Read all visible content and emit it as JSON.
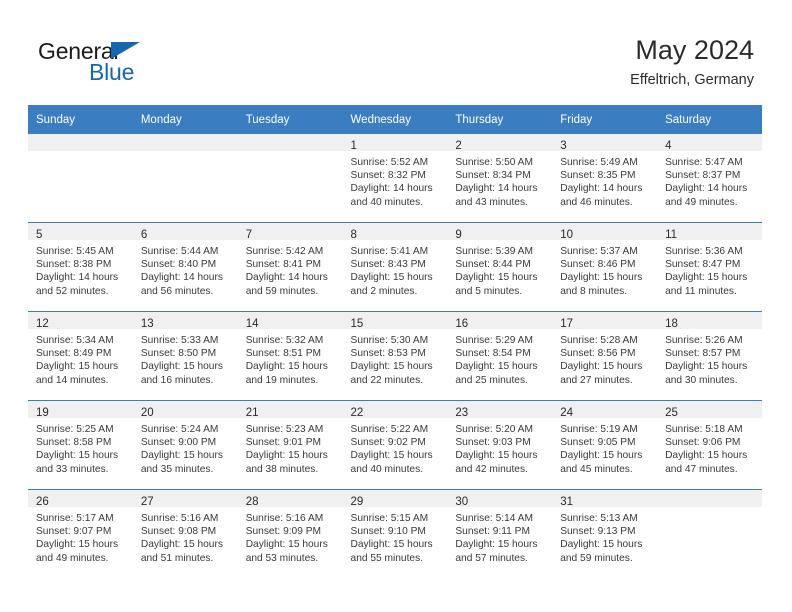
{
  "brand": {
    "name_part1": "General",
    "name_part2": "Blue",
    "triangle_color": "#1666b0",
    "blue_color": "#1666b0"
  },
  "header": {
    "title": "May 2024",
    "subtitle": "Effeltrich, Germany"
  },
  "theme": {
    "header_blue": "#3a7dc1",
    "day_band_gray": "#f0f0f0",
    "text_color": "#3a3a3a"
  },
  "weekday_headers": [
    "Sunday",
    "Monday",
    "Tuesday",
    "Wednesday",
    "Thursday",
    "Friday",
    "Saturday"
  ],
  "weeks": [
    [
      {
        "day": "",
        "sunrise": "",
        "sunset": "",
        "daylight": ""
      },
      {
        "day": "",
        "sunrise": "",
        "sunset": "",
        "daylight": ""
      },
      {
        "day": "",
        "sunrise": "",
        "sunset": "",
        "daylight": ""
      },
      {
        "day": "1",
        "sunrise": "Sunrise: 5:52 AM",
        "sunset": "Sunset: 8:32 PM",
        "daylight": "Daylight: 14 hours and 40 minutes."
      },
      {
        "day": "2",
        "sunrise": "Sunrise: 5:50 AM",
        "sunset": "Sunset: 8:34 PM",
        "daylight": "Daylight: 14 hours and 43 minutes."
      },
      {
        "day": "3",
        "sunrise": "Sunrise: 5:49 AM",
        "sunset": "Sunset: 8:35 PM",
        "daylight": "Daylight: 14 hours and 46 minutes."
      },
      {
        "day": "4",
        "sunrise": "Sunrise: 5:47 AM",
        "sunset": "Sunset: 8:37 PM",
        "daylight": "Daylight: 14 hours and 49 minutes."
      }
    ],
    [
      {
        "day": "5",
        "sunrise": "Sunrise: 5:45 AM",
        "sunset": "Sunset: 8:38 PM",
        "daylight": "Daylight: 14 hours and 52 minutes."
      },
      {
        "day": "6",
        "sunrise": "Sunrise: 5:44 AM",
        "sunset": "Sunset: 8:40 PM",
        "daylight": "Daylight: 14 hours and 56 minutes."
      },
      {
        "day": "7",
        "sunrise": "Sunrise: 5:42 AM",
        "sunset": "Sunset: 8:41 PM",
        "daylight": "Daylight: 14 hours and 59 minutes."
      },
      {
        "day": "8",
        "sunrise": "Sunrise: 5:41 AM",
        "sunset": "Sunset: 8:43 PM",
        "daylight": "Daylight: 15 hours and 2 minutes."
      },
      {
        "day": "9",
        "sunrise": "Sunrise: 5:39 AM",
        "sunset": "Sunset: 8:44 PM",
        "daylight": "Daylight: 15 hours and 5 minutes."
      },
      {
        "day": "10",
        "sunrise": "Sunrise: 5:37 AM",
        "sunset": "Sunset: 8:46 PM",
        "daylight": "Daylight: 15 hours and 8 minutes."
      },
      {
        "day": "11",
        "sunrise": "Sunrise: 5:36 AM",
        "sunset": "Sunset: 8:47 PM",
        "daylight": "Daylight: 15 hours and 11 minutes."
      }
    ],
    [
      {
        "day": "12",
        "sunrise": "Sunrise: 5:34 AM",
        "sunset": "Sunset: 8:49 PM",
        "daylight": "Daylight: 15 hours and 14 minutes."
      },
      {
        "day": "13",
        "sunrise": "Sunrise: 5:33 AM",
        "sunset": "Sunset: 8:50 PM",
        "daylight": "Daylight: 15 hours and 16 minutes."
      },
      {
        "day": "14",
        "sunrise": "Sunrise: 5:32 AM",
        "sunset": "Sunset: 8:51 PM",
        "daylight": "Daylight: 15 hours and 19 minutes."
      },
      {
        "day": "15",
        "sunrise": "Sunrise: 5:30 AM",
        "sunset": "Sunset: 8:53 PM",
        "daylight": "Daylight: 15 hours and 22 minutes."
      },
      {
        "day": "16",
        "sunrise": "Sunrise: 5:29 AM",
        "sunset": "Sunset: 8:54 PM",
        "daylight": "Daylight: 15 hours and 25 minutes."
      },
      {
        "day": "17",
        "sunrise": "Sunrise: 5:28 AM",
        "sunset": "Sunset: 8:56 PM",
        "daylight": "Daylight: 15 hours and 27 minutes."
      },
      {
        "day": "18",
        "sunrise": "Sunrise: 5:26 AM",
        "sunset": "Sunset: 8:57 PM",
        "daylight": "Daylight: 15 hours and 30 minutes."
      }
    ],
    [
      {
        "day": "19",
        "sunrise": "Sunrise: 5:25 AM",
        "sunset": "Sunset: 8:58 PM",
        "daylight": "Daylight: 15 hours and 33 minutes."
      },
      {
        "day": "20",
        "sunrise": "Sunrise: 5:24 AM",
        "sunset": "Sunset: 9:00 PM",
        "daylight": "Daylight: 15 hours and 35 minutes."
      },
      {
        "day": "21",
        "sunrise": "Sunrise: 5:23 AM",
        "sunset": "Sunset: 9:01 PM",
        "daylight": "Daylight: 15 hours and 38 minutes."
      },
      {
        "day": "22",
        "sunrise": "Sunrise: 5:22 AM",
        "sunset": "Sunset: 9:02 PM",
        "daylight": "Daylight: 15 hours and 40 minutes."
      },
      {
        "day": "23",
        "sunrise": "Sunrise: 5:20 AM",
        "sunset": "Sunset: 9:03 PM",
        "daylight": "Daylight: 15 hours and 42 minutes."
      },
      {
        "day": "24",
        "sunrise": "Sunrise: 5:19 AM",
        "sunset": "Sunset: 9:05 PM",
        "daylight": "Daylight: 15 hours and 45 minutes."
      },
      {
        "day": "25",
        "sunrise": "Sunrise: 5:18 AM",
        "sunset": "Sunset: 9:06 PM",
        "daylight": "Daylight: 15 hours and 47 minutes."
      }
    ],
    [
      {
        "day": "26",
        "sunrise": "Sunrise: 5:17 AM",
        "sunset": "Sunset: 9:07 PM",
        "daylight": "Daylight: 15 hours and 49 minutes."
      },
      {
        "day": "27",
        "sunrise": "Sunrise: 5:16 AM",
        "sunset": "Sunset: 9:08 PM",
        "daylight": "Daylight: 15 hours and 51 minutes."
      },
      {
        "day": "28",
        "sunrise": "Sunrise: 5:16 AM",
        "sunset": "Sunset: 9:09 PM",
        "daylight": "Daylight: 15 hours and 53 minutes."
      },
      {
        "day": "29",
        "sunrise": "Sunrise: 5:15 AM",
        "sunset": "Sunset: 9:10 PM",
        "daylight": "Daylight: 15 hours and 55 minutes."
      },
      {
        "day": "30",
        "sunrise": "Sunrise: 5:14 AM",
        "sunset": "Sunset: 9:11 PM",
        "daylight": "Daylight: 15 hours and 57 minutes."
      },
      {
        "day": "31",
        "sunrise": "Sunrise: 5:13 AM",
        "sunset": "Sunset: 9:13 PM",
        "daylight": "Daylight: 15 hours and 59 minutes."
      },
      {
        "day": "",
        "sunrise": "",
        "sunset": "",
        "daylight": ""
      }
    ]
  ]
}
